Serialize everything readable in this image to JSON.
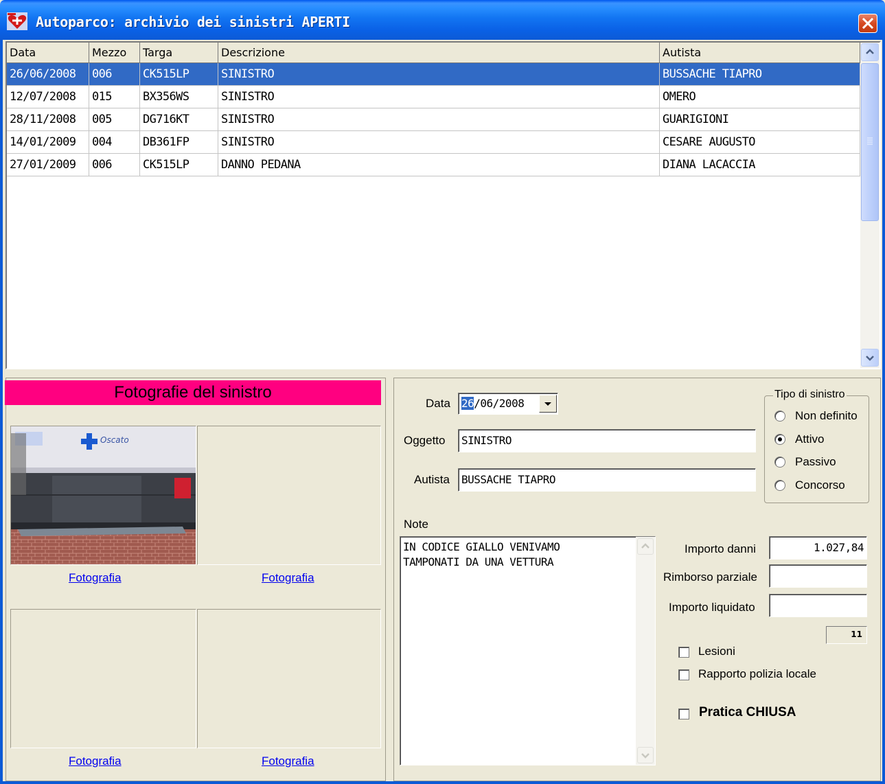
{
  "window": {
    "title": "Autoparco: archivio dei sinistri APERTI"
  },
  "grid": {
    "columns": [
      "Data",
      "Mezzo",
      "Targa",
      "Descrizione",
      "Autista"
    ],
    "rows": [
      [
        "26/06/2008",
        "006",
        "CK515LP",
        "SINISTRO",
        "BUSSACHE TIAPRO"
      ],
      [
        "12/07/2008",
        "015",
        "BX356WS",
        "SINISTRO",
        "OMERO"
      ],
      [
        "28/11/2008",
        "005",
        "DG716KT",
        "SINISTRO",
        "GUARIGIONI"
      ],
      [
        "14/01/2009",
        "004",
        "DB361FP",
        "SINISTRO",
        "CESARE AUGUSTO"
      ],
      [
        "27/01/2009",
        "006",
        "CK515LP",
        "DANNO PEDANA",
        "DIANA LACACCIA"
      ]
    ],
    "selected_row": 0
  },
  "photos": {
    "header": "Fotografie del sinistro",
    "links": [
      "Fotografia",
      "Fotografia",
      "Fotografia",
      "Fotografia"
    ],
    "photo1_text": "Oscato"
  },
  "details": {
    "data_label": "Data",
    "data_day": "26",
    "data_rest": "/06/2008",
    "oggetto_label": "Oggetto",
    "oggetto_value": "SINISTRO",
    "autista_label": "Autista",
    "autista_value": "BUSSACHE TIAPRO",
    "tipo_title": "Tipo di sinistro",
    "tipo_options": [
      "Non definito",
      "Attivo",
      "Passivo",
      "Concorso"
    ],
    "tipo_selected": 1,
    "note_label": "Note",
    "note_value": "IN CODICE GIALLO VENIVAMO\nTAMPONATI DA UNA VETTURA",
    "importo_danni_label": "Importo danni",
    "importo_danni_value": "1.027,84",
    "rimborso_label": "Rimborso parziale",
    "rimborso_value": "",
    "liquidato_label": "Importo liquidato",
    "liquidato_value": "",
    "counter": "11",
    "lesioni_label": "Lesioni",
    "rapporto_label": "Rapporto polizia locale",
    "chiusa_label": "Pratica CHIUSA"
  },
  "colors": {
    "title_blue": "#0a61e6",
    "selection": "#316ac5",
    "photos_header": "#ff0080",
    "link": "#0000ee"
  }
}
